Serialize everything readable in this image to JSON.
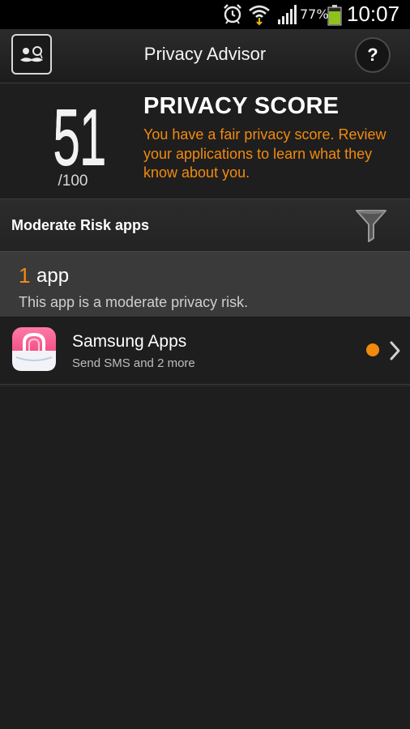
{
  "status_bar": {
    "battery_percent": "77%",
    "battery_level": 0.77,
    "clock": "10:07",
    "icons": [
      "alarm-icon",
      "wifi-icon",
      "signal-icon",
      "battery-icon"
    ]
  },
  "action_bar": {
    "title": "Privacy Advisor",
    "help_label": "?",
    "logo_icon": "spy-face-icon"
  },
  "score": {
    "value": "51",
    "max": "/100",
    "heading": "PRIVACY SCORE",
    "description": "You have a fair privacy score. Review your applications to learn what they know about you."
  },
  "section": {
    "title": "Moderate Risk apps",
    "filter_icon": "filter-icon"
  },
  "summary": {
    "count": "1",
    "unit": "app",
    "description": "This app is a moderate privacy risk."
  },
  "apps": [
    {
      "name": "Samsung Apps",
      "permissions": "Send SMS and 2 more",
      "risk_color": "#f28a0e",
      "icon": "shopping-bag-icon"
    }
  ],
  "colors": {
    "accent": "#f28a0e",
    "background": "#1e1e1f",
    "summary_bg": "#3a3a3b"
  }
}
